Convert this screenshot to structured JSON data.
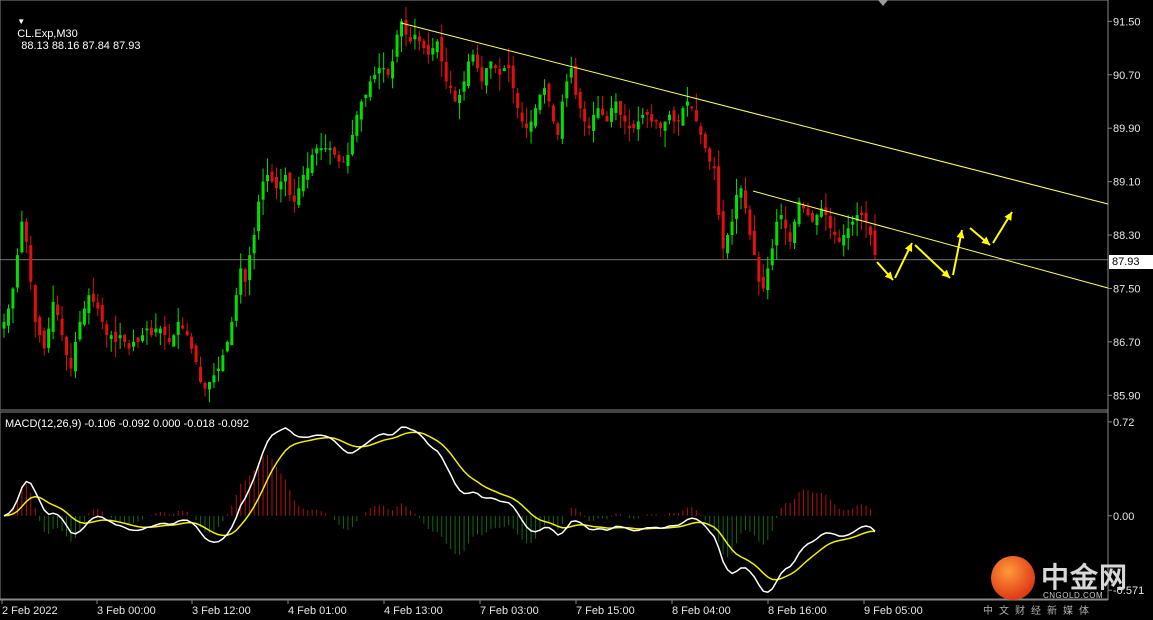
{
  "chart_header": {
    "symbol_timeframe": "CL.Exp,M30",
    "ohlc": "88.13 88.16 87.84 87.93"
  },
  "macd_header": {
    "text": "MACD(12,26,9) -0.106 -0.092 0.000 -0.018 -0.092"
  },
  "watermark": {
    "name": "中金网",
    "url": "CNGOLD.COM",
    "subtitle": "中文财经新媒体"
  },
  "colors": {
    "background": "#000000",
    "bull": "#00e000",
    "bear": "#e01010",
    "trendline": "#ffff66",
    "arrow": "#ffff00",
    "macd_line": "#ffffff",
    "signal_line": "#f0f000",
    "hist_pos": "#b01010",
    "hist_neg": "#106a10"
  },
  "chart_data": [
    {
      "type": "candlestick",
      "title": "CL.Exp,M30",
      "y_ticks": [
        91.5,
        90.7,
        89.9,
        89.1,
        88.3,
        87.5,
        86.7,
        85.9
      ],
      "ylim": [
        85.8,
        91.7
      ],
      "current_price": 87.93,
      "x_ticks": [
        "2 Feb 2022",
        "3 Feb 00:00",
        "3 Feb 12:00",
        "4 Feb 01:00",
        "4 Feb 13:00",
        "7 Feb 03:00",
        "7 Feb 15:00",
        "8 Feb 04:00",
        "8 Feb 16:00",
        "9 Feb 05:00"
      ],
      "close": [
        87.0,
        87.2,
        87.5,
        88.0,
        88.5,
        88.2,
        87.6,
        87.0,
        86.8,
        86.6,
        86.9,
        87.3,
        87.1,
        86.8,
        86.5,
        86.3,
        86.7,
        87.0,
        87.2,
        87.4,
        87.3,
        87.2,
        87.0,
        86.8,
        86.8,
        86.7,
        86.8,
        86.7,
        86.6,
        86.7,
        86.7,
        86.8,
        86.9,
        86.8,
        86.9,
        86.9,
        86.8,
        86.7,
        86.8,
        87.0,
        86.9,
        86.8,
        86.6,
        86.4,
        86.1,
        86.0,
        86.1,
        86.2,
        86.3,
        86.5,
        86.7,
        87.0,
        87.4,
        87.8,
        87.6,
        88.0,
        88.3,
        88.8,
        89.1,
        89.2,
        89.1,
        89.0,
        89.1,
        89.2,
        88.9,
        88.8,
        89.0,
        89.2,
        89.3,
        89.5,
        89.6,
        89.6,
        89.6,
        89.6,
        89.5,
        89.4,
        89.4,
        89.5,
        89.8,
        90.1,
        90.3,
        90.4,
        90.6,
        90.7,
        90.8,
        90.8,
        90.7,
        90.9,
        91.3,
        91.5,
        91.3,
        91.2,
        91.3,
        91.2,
        91.1,
        91.0,
        91.1,
        91.2,
        90.9,
        90.6,
        90.5,
        90.3,
        90.4,
        90.6,
        90.9,
        91.0,
        90.8,
        90.6,
        90.8,
        90.9,
        90.8,
        90.7,
        90.8,
        90.8,
        90.5,
        90.2,
        90.0,
        89.9,
        90.0,
        90.2,
        90.4,
        90.5,
        90.3,
        90.0,
        89.8,
        90.3,
        90.6,
        90.8,
        90.4,
        90.2,
        90.0,
        89.9,
        90.1,
        90.2,
        90.1,
        90.0,
        90.2,
        90.3,
        90.1,
        90.0,
        89.9,
        89.9,
        90.0,
        90.1,
        90.1,
        90.0,
        90.0,
        89.9,
        90.0,
        90.1,
        90.0,
        90.0,
        90.2,
        90.3,
        90.2,
        90.0,
        89.8,
        89.6,
        89.4,
        89.3,
        88.6,
        88.1,
        88.3,
        88.5,
        88.9,
        89.0,
        88.7,
        88.3,
        88.0,
        87.6,
        87.5,
        87.8,
        88.1,
        88.5,
        88.6,
        88.4,
        88.2,
        88.5,
        88.8,
        88.7,
        88.6,
        88.5,
        88.6,
        88.7,
        88.6,
        88.4,
        88.3,
        88.2,
        88.3,
        88.4,
        88.5,
        88.6,
        88.6,
        88.5,
        88.3,
        88.0
      ]
    },
    {
      "type": "macd",
      "title": "MACD(12,26,9)",
      "values": {
        "macd_main": -0.106,
        "signal": -0.092
      },
      "y_ticks": [
        0.72,
        0.0,
        -0.571
      ],
      "ylim": [
        -0.6,
        0.75
      ]
    }
  ],
  "labels": {
    "price_badge": "87.93"
  }
}
